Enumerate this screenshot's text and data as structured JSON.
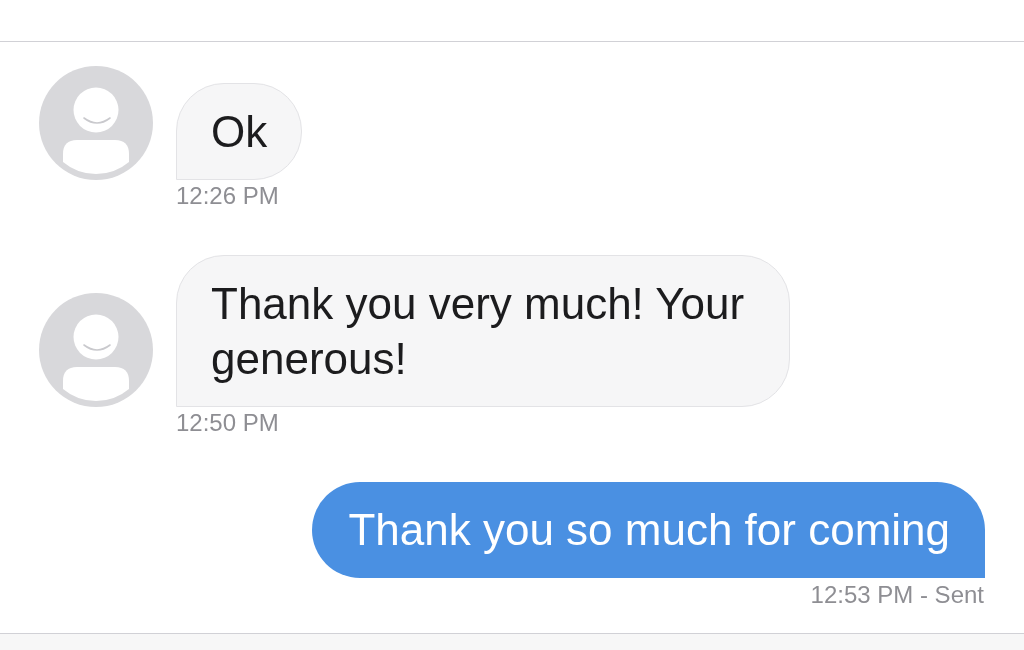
{
  "messages": [
    {
      "kind": "received",
      "text": "Ok",
      "time": "12:26 PM"
    },
    {
      "kind": "received",
      "text": "Thank you very much! Your generous!",
      "time": "12:50 PM"
    },
    {
      "kind": "sent",
      "text": "Thank you so much for coming",
      "time": "12:53 PM - Sent"
    }
  ]
}
